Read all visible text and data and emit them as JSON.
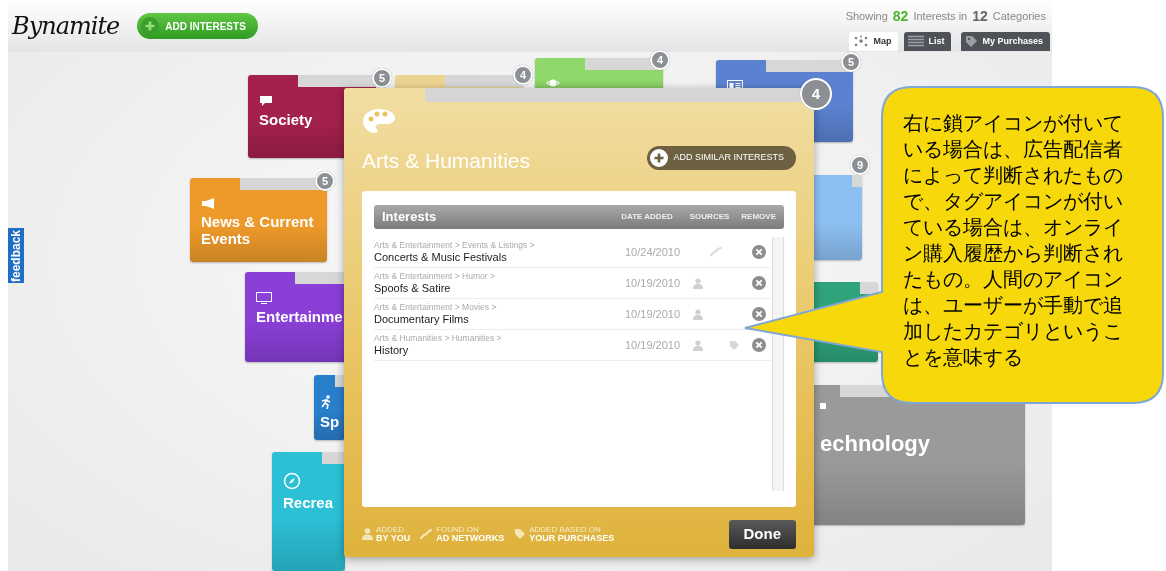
{
  "header": {
    "logo": "Bynamite",
    "add_button": "ADD INTERESTS",
    "summary": {
      "prefix": "Showing",
      "interests_count": "82",
      "middle": "Interests in",
      "categories_count": "12",
      "suffix": "Categories"
    },
    "views": [
      {
        "label": "Map",
        "kind": "map",
        "selected": true
      },
      {
        "label": "List",
        "kind": "list",
        "selected": false
      },
      {
        "label": "My Purchases",
        "kind": "purchases",
        "selected": false
      }
    ]
  },
  "feedback_tab": "feedback",
  "categories": [
    {
      "label": "Society",
      "count": "5",
      "color": "#a3214c",
      "kind": "speech"
    },
    {
      "count": "4",
      "color": "#ecd490",
      "kind": "none"
    },
    {
      "count": "4",
      "color": "#8fd86a",
      "kind": "planet"
    },
    {
      "count": "5",
      "color": "#5a82d0",
      "kind": "idcard"
    },
    {
      "count": "9",
      "color": "#8dc0f2",
      "kind": "none"
    },
    {
      "label": "News & Current Events",
      "count": "5",
      "color": "#ee9a2a",
      "kind": "megaphone"
    },
    {
      "label": "Entertainme",
      "color": "#8a3fd6",
      "kind": "tv"
    },
    {
      "color": "#2fa37a",
      "kind": "none"
    },
    {
      "label": "Sp",
      "color": "#2a7fcc",
      "kind": "runner"
    },
    {
      "label": "Recrea",
      "color": "#2cc0d6",
      "kind": "compass"
    },
    {
      "label": "echnology",
      "color": "#9a9a9a",
      "kind": "chip"
    }
  ],
  "modal": {
    "count": "4",
    "title": "Arts & Humanities",
    "add_similar": "ADD SIMILAR INTERESTS",
    "table": {
      "columns": [
        "Interests",
        "DATE ADDED",
        "SOURCES",
        "REMOVE"
      ],
      "rows": [
        {
          "path": "Arts & Entertainment > Events & Listings >",
          "name": "Concerts & Music Festivals",
          "date": "10/24/2010",
          "by_you": false,
          "ad_network": true,
          "purchase": false
        },
        {
          "path": "Arts & Entertainment > Humor >",
          "name": "Spoofs & Satire",
          "date": "10/19/2010",
          "by_you": true,
          "ad_network": false,
          "purchase": false
        },
        {
          "path": "Arts & Entertainment > Movies >",
          "name": "Documentary Films",
          "date": "10/19/2010",
          "by_you": true,
          "ad_network": false,
          "purchase": false
        },
        {
          "path": "Arts & Humanities > Humanities >",
          "name": "History",
          "date": "10/19/2010",
          "by_you": true,
          "ad_network": false,
          "purchase": true
        }
      ]
    },
    "legend": [
      {
        "kind": "user",
        "line1": "ADDED",
        "line2": "BY YOU"
      },
      {
        "kind": "chain",
        "line1": "FOUND ON",
        "line2": "AD NETWORKS"
      },
      {
        "kind": "tag",
        "line1": "ADDED BASED ON",
        "line2": "YOUR PURCHASES"
      }
    ],
    "done": "Done"
  },
  "callout": {
    "text": "右に鎖アイコンが付いている場合は、広告配信者によって判断されたもので、タグアイコンが付いている場合は、オンライン購入履歴から判断されたもの。人間のアイコンは、ユーザーが手動で追加したカテゴリということを意味する"
  }
}
